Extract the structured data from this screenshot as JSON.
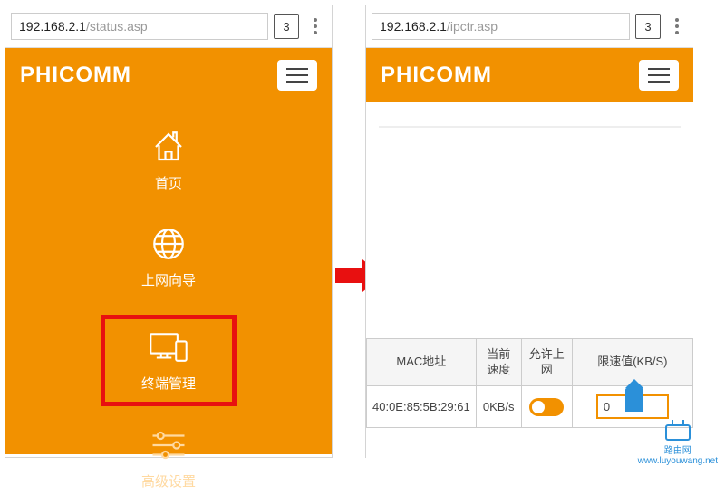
{
  "colors": {
    "accent": "#f29100",
    "highlight": "#e81010",
    "link": "#2b90d9"
  },
  "left": {
    "url_host": "192.168.2.1",
    "url_path": "/status.asp",
    "tab_count": "3",
    "brand": "PHICOMM",
    "menu": [
      {
        "icon": "home-icon",
        "label": "首页"
      },
      {
        "icon": "globe-icon",
        "label": "上网向导"
      },
      {
        "icon": "devices-icon",
        "label": "终端管理",
        "highlighted": true
      },
      {
        "icon": "sliders-icon",
        "label": "高级设置",
        "muted": true
      }
    ]
  },
  "right": {
    "url_host": "192.168.2.1",
    "url_path": "/ipctr.asp",
    "tab_count": "3",
    "brand": "PHICOMM",
    "table": {
      "headers": {
        "mac": "MAC地址",
        "speed": "当前速度",
        "allow": "允许上网",
        "limit": "限速值(KB/S)"
      },
      "rows": [
        {
          "mac": "40:0E:85:5B:29:61",
          "speed": "0KB/s",
          "allow": true,
          "limit": "0"
        }
      ]
    }
  },
  "watermark": {
    "label": "路由网",
    "url": "www.luyouwang.net"
  }
}
